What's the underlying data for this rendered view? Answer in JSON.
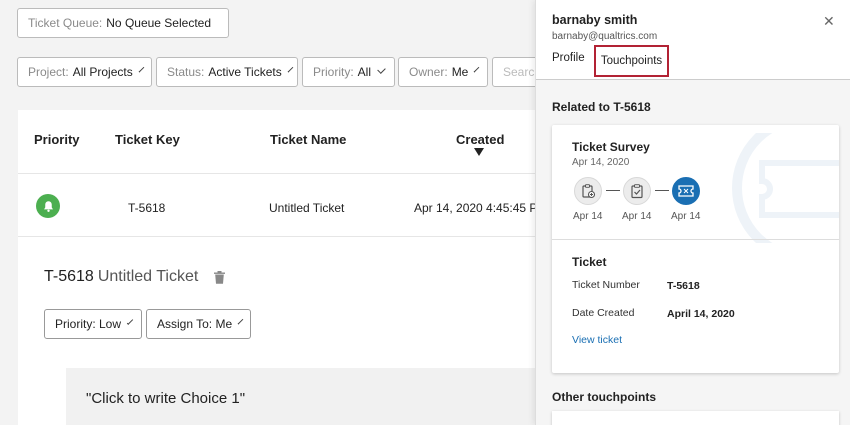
{
  "filters": {
    "queue": {
      "label": "Ticket Queue:",
      "value": "No Queue Selected"
    },
    "project": {
      "label": "Project:",
      "value": "All Projects"
    },
    "status": {
      "label": "Status:",
      "value": "Active Tickets"
    },
    "priority": {
      "label": "Priority:",
      "value": "All"
    },
    "owner": {
      "label": "Owner:",
      "value": "Me"
    },
    "search_placeholder": "Search"
  },
  "table": {
    "headers": [
      "Priority",
      "Ticket Key",
      "Ticket Name",
      "Created"
    ],
    "rows": [
      {
        "key": "T-5618",
        "name": "Untitled Ticket",
        "created": "Apr 14, 2020 4:45:45 P"
      }
    ]
  },
  "detail": {
    "key": "T-5618",
    "name": "Untitled Ticket",
    "priority_btn": "Priority: Low",
    "assign_btn": "Assign To: Me",
    "choice_text": "\"Click to write Choice 1\""
  },
  "panel": {
    "user_name": "barnaby smith",
    "user_email": "barnaby@qualtrics.com",
    "tabs": [
      "Profile",
      "Touchpoints"
    ],
    "active_tab": "Touchpoints",
    "related_title": "Related to T-5618",
    "survey": {
      "title": "Ticket Survey",
      "date": "Apr 14, 2020",
      "touchpoints": [
        {
          "icon": "clipboard-add-icon",
          "date": "Apr 14"
        },
        {
          "icon": "clipboard-check-icon",
          "date": "Apr 14"
        },
        {
          "icon": "ticket-icon",
          "date": "Apr 14"
        }
      ]
    },
    "ticket": {
      "title": "Ticket",
      "number_label": "Ticket Number",
      "number_value": "T-5618",
      "date_label": "Date Created",
      "date_value": "April 14, 2020",
      "view_link": "View ticket"
    },
    "other_title": "Other touchpoints"
  },
  "colors": {
    "accent": "#1a6fb3",
    "tab_highlight": "#b22234",
    "priority_green": "#4caf50"
  }
}
